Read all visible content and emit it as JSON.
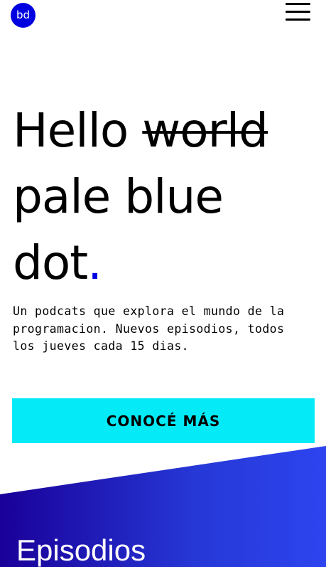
{
  "header": {
    "logo_text": "bd",
    "menu_icon": "hamburger-icon"
  },
  "hero": {
    "word_hello": "Hello",
    "word_struck": "world",
    "line2": "pale blue",
    "line3": "dot",
    "accent_dot": "."
  },
  "description": "Un podcats que explora el mundo de la programacion. Nuevos episodios, todos los jueves cada 15 dias.",
  "cta": {
    "label": "CONOCÉ MÁS"
  },
  "episodes": {
    "title": "Episodios"
  },
  "colors": {
    "brand_blue": "#0000e0",
    "cta_cyan": "#04ebf7",
    "gradient_start": "#1a0099",
    "gradient_end": "#2d44ef"
  }
}
